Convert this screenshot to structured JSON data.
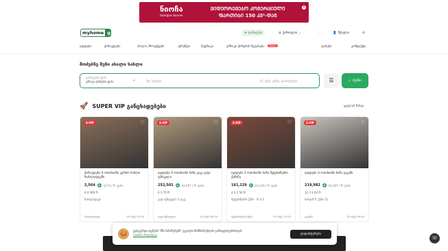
{
  "banner": {
    "brand": "ნიოჩა",
    "brand_sub": "Georgian banner",
    "line1": "ᲕᲘᲓᲔᲝᲠᲔᲒᲔᲑᲝ ᲙᲝᲛᲔᲠᲪᲘᲣᲚᲘ",
    "line2": "ᲤᲐᲠᲗᲘᲑᲘ 150 ᲙᲕ²-ᲓᲐᲜ"
  },
  "header": {
    "brand_a": "myhome",
    "brand_b": "ge",
    "add_label": "დამატება",
    "lang_label": "ქართული",
    "login_label": "შესვლა"
  },
  "nav": {
    "items": [
      "იყიდება",
      "ქირავდება",
      "ახალი პროექტები",
      "ტრენდი",
      "მეტრიკა",
      "უძრავი ქონების შეფასება"
    ],
    "badge": "ახალი",
    "right": [
      "ფასები",
      "კონტაქტი"
    ]
  },
  "hero": {
    "title": "მოძებნე შენი ახალი სახლი"
  },
  "search": {
    "deal_label": "გარიგების ტიპი",
    "deal_value": "უძრავი ქონების ტიპი",
    "city_placeholder": "მდ. სახელი",
    "loc_placeholder": "ID, ქუჩა, უბანი, დასახელება",
    "search_label": "ძებნა"
  },
  "vip": {
    "title": "SUPER VIP განცხადებები",
    "see_all": "ყველას ნახვა"
  },
  "cards": [
    {
      "tag": "S-VIP",
      "title": "ქირავდება 4 ოთახიანი კერძო სახლი ნაძალადევში",
      "price": "2,564",
      "per": "$174 / მ² ფასი",
      "feat": "6  4  300 მ²",
      "loc": "ნაძალადევი",
      "foot_l": "ნაძალადევი",
      "foot_r": "02 ოქტ 20:35",
      "bg": "#8a6f5a"
    },
    {
      "tag": "S-VIP",
      "title": "იყიდება 3 ოთახიანი ბინა ვაკე ვაჟა-ფშაველა",
      "price": "252,501",
      "per": "$1,607 / მ² ფასი",
      "feat": "6  3  70 მ²",
      "loc": "ვაჟა-ფშაველა 3 ვაკე",
      "foot_l": "ვაჟა-ფშაველა",
      "foot_r": "03 ოქტ 06:30",
      "bg": "#b39a7e"
    },
    {
      "tag": "S-VIP",
      "title": "იყიდება 2 ოთახიანი ბინა მეტეხინების ქუჩაზე",
      "price": "161,229",
      "per": "$1,214 / მ² ფასი",
      "feat": "4  3  1  56 მ²",
      "loc": "მეტეხინების ქუჩა - IV ბ.2",
      "foot_l": "მეტეხინების ქუჩა",
      "foot_r": "02 ოქტ 14:25",
      "bg": "#7a4a3a"
    },
    {
      "tag": "S-VIP",
      "title": "იყიდება 3 ოთახიანი ბინა ვაკეში",
      "price": "219,982",
      "per": "$1,037 / მ² ფასი",
      "feat": "12  3  1  62 მ²",
      "loc": "საიდან მ. ქუჩა 21",
      "foot_l": "ვაკეში",
      "foot_r": "02 ოქტ 09:45",
      "bg": "#c9c5be"
    }
  ],
  "cookie": {
    "text": "ვებგვერდი იყენებს \"მზა ჩანაწერებს\" უკეთესი მომხმარებლის გამოცდილებისთვის",
    "link": "Cookie პოლიტიკა",
    "button": "დადასტურება"
  }
}
